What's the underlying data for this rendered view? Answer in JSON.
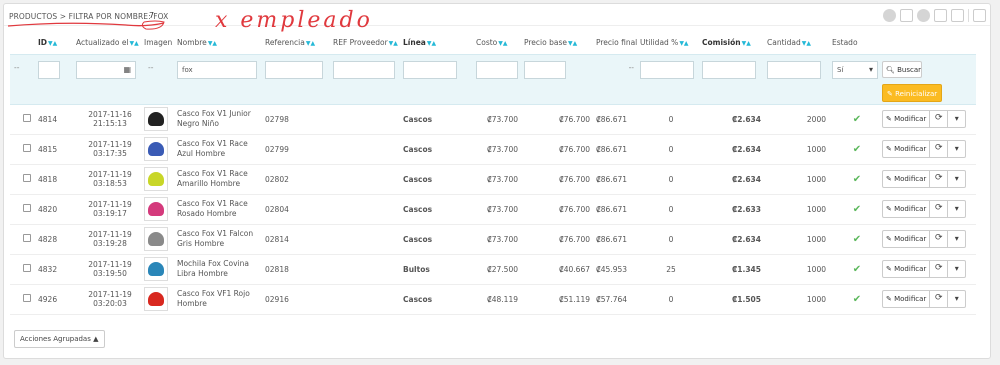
{
  "header": {
    "breadcrumb": "PRODUCTOS > FILTRA POR NOMBRE: FOX",
    "count": "7",
    "handwritten": "x empleado",
    "toolbar_icons": [
      "add-icon",
      "import-icon",
      "export-icon",
      "code-icon",
      "refresh-icon",
      "database-icon"
    ]
  },
  "columns": {
    "id": "ID",
    "updated": "Actualizado el",
    "image": "Imagen",
    "name": "Nombre",
    "reference": "Referencia",
    "supplier_ref": "REF Proveedor",
    "line": "Línea",
    "cost": "Costo",
    "base_price": "Precio base",
    "final_price": "Precio final",
    "utility": "Utilidad %",
    "commission": "Comisión",
    "quantity": "Cantidad",
    "status": "Estado"
  },
  "filters": {
    "dash": "--",
    "name_value": "fox",
    "final_price_dash": "--",
    "status_value": "Sí",
    "search_label": "Buscar",
    "reset_label": "Reinicializar"
  },
  "rows": [
    {
      "id": "4814",
      "date": "2017-11-16",
      "time": "21:15:13",
      "name": "Casco Fox V1 Junior Negro Niño",
      "ref": "02798",
      "line": "Cascos",
      "cost": "₡73.700",
      "base": "₡76.700",
      "final": "₡86.671",
      "utility": "0",
      "commission": "₡2.634",
      "qty": "2000",
      "color": "#222222"
    },
    {
      "id": "4815",
      "date": "2017-11-19",
      "time": "03:17:35",
      "name": "Casco Fox V1 Race Azul Hombre",
      "ref": "02799",
      "line": "Cascos",
      "cost": "₡73.700",
      "base": "₡76.700",
      "final": "₡86.671",
      "utility": "0",
      "commission": "₡2.634",
      "qty": "1000",
      "color": "#3a5bb5"
    },
    {
      "id": "4818",
      "date": "2017-11-19",
      "time": "03:18:53",
      "name": "Casco Fox V1 Race Amarillo Hombre",
      "ref": "02802",
      "line": "Cascos",
      "cost": "₡73.700",
      "base": "₡76.700",
      "final": "₡86.671",
      "utility": "0",
      "commission": "₡2.634",
      "qty": "1000",
      "color": "#c8d628"
    },
    {
      "id": "4820",
      "date": "2017-11-19",
      "time": "03:19:17",
      "name": "Casco Fox V1 Race Rosado Hombre",
      "ref": "02804",
      "line": "Cascos",
      "cost": "₡73.700",
      "base": "₡76.700",
      "final": "₡86.671",
      "utility": "0",
      "commission": "₡2.633",
      "qty": "1000",
      "color": "#d43a7c"
    },
    {
      "id": "4828",
      "date": "2017-11-19",
      "time": "03:19:28",
      "name": "Casco Fox V1 Falcon Gris Hombre",
      "ref": "02814",
      "line": "Cascos",
      "cost": "₡73.700",
      "base": "₡76.700",
      "final": "₡86.671",
      "utility": "0",
      "commission": "₡2.634",
      "qty": "1000",
      "color": "#8a8a8a"
    },
    {
      "id": "4832",
      "date": "2017-11-19",
      "time": "03:19:50",
      "name": "Mochila Fox Covina Libra Hombre",
      "ref": "02818",
      "line": "Bultos",
      "cost": "₡27.500",
      "base": "₡40.667",
      "final": "₡45.953",
      "utility": "25",
      "commission": "₡1.345",
      "qty": "1000",
      "color": "#2a86b8"
    },
    {
      "id": "4926",
      "date": "2017-11-19",
      "time": "03:20:03",
      "name": "Casco Fox VF1 Rojo Hombre",
      "ref": "02916",
      "line": "Cascos",
      "cost": "₡48.119",
      "base": "₡51.119",
      "final": "₡57.764",
      "utility": "0",
      "commission": "₡1.505",
      "qty": "1000",
      "color": "#d8281f"
    }
  ],
  "row_actions": {
    "modify_label": "Modificar"
  },
  "footer": {
    "bulk_label": "Acciones Agrupadas"
  }
}
